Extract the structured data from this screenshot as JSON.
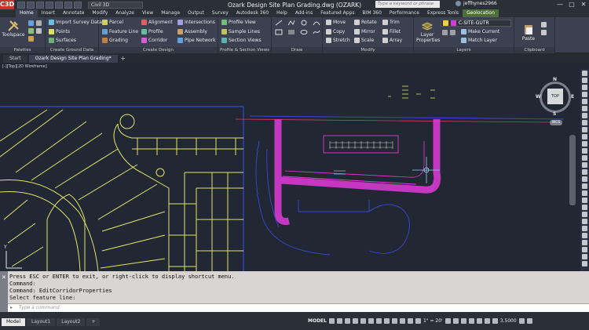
{
  "app": {
    "logo": "C3D",
    "workspace": "Civil 3D",
    "document_title": "Ozark Design Site Plan Grading.dwg (OZARK)",
    "search_placeholder": "Type a keyword or phrase",
    "user": "jeffhynes2966",
    "window_controls": [
      "—",
      "□",
      "✕"
    ]
  },
  "ribbon_tabs": [
    "Home",
    "Insert",
    "Annotate",
    "Modify",
    "Analyze",
    "View",
    "Manage",
    "Output",
    "Survey",
    "Autodesk 360",
    "Help",
    "Add-ins",
    "Featured Apps",
    "BIM 360",
    "Performance",
    "Express Tools",
    "Geolocation"
  ],
  "ribbon_active_tab": "Home",
  "panels": {
    "palettes": {
      "title": "Palettes",
      "toolspace": "Toolspace"
    },
    "create_ground_data": {
      "title": "Create Ground Data",
      "items": [
        "Import Survey Data",
        "Points",
        "Surfaces"
      ]
    },
    "create_design": {
      "title": "Create Design",
      "items": [
        "Parcel",
        "Feature Line",
        "Grading",
        "Alignment",
        "Profile",
        "Corridor",
        "Intersections",
        "Assembly",
        "Pipe Network"
      ]
    },
    "profile_section_views": {
      "title": "Profile & Section Views",
      "items": [
        "Profile View",
        "Sample Lines",
        "Section Views"
      ]
    },
    "draw": {
      "title": "Draw"
    },
    "modify": {
      "title": "Modify",
      "items": [
        "Move",
        "Copy",
        "Stretch",
        "Rotate",
        "Mirror",
        "Scale",
        "Trim",
        "Fillet",
        "Array"
      ]
    },
    "layers": {
      "title": "Layers",
      "properties": "Layer Properties",
      "current_layer": "C-SITE-GUTR",
      "make_current": "Make Current",
      "match_layer": "Match Layer"
    },
    "clipboard": {
      "title": "Clipboard",
      "paste": "Paste"
    }
  },
  "doc_tabs": [
    "Start",
    "Ozark Design Site Plan Grading*"
  ],
  "doc_tab_add": "+",
  "viewport": {
    "label": "[-][Top][2D Wireframe]",
    "cube_face": "TOP",
    "compass": {
      "n": "N",
      "s": "S",
      "e": "E",
      "w": "W"
    },
    "wcs": "WCS",
    "ucs_y": "Y"
  },
  "command": {
    "close_glyph": "✕",
    "history": [
      "Press ESC or ENTER to exit, or right-click to display shortcut menu.",
      "Command:",
      "Command: EditCorridorProperties",
      "Select feature line:"
    ],
    "placeholder": "Type a command"
  },
  "status": {
    "layout_tabs": [
      "Model",
      "Layout1",
      "Layout2"
    ],
    "add_layout": "+",
    "model_label": "MODEL",
    "annotation_scale": "1\" = 20'",
    "scale_value": "3.5000"
  },
  "colors": {
    "parcel_lines": "#e3e36a",
    "corridor": "#e13ad9",
    "alignment": "#3848d6",
    "ribbon_bg": "#3b4150",
    "drawing_bg": "#212833",
    "layer_swatch": "#d63bd6"
  }
}
